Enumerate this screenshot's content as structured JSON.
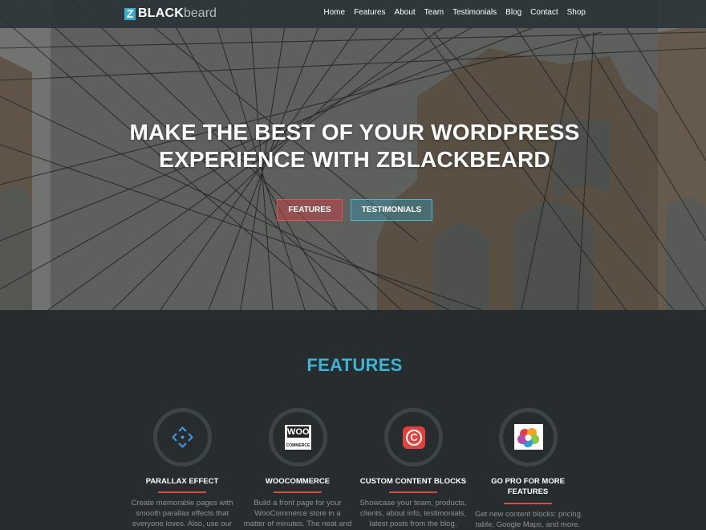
{
  "colors": {
    "accent_blue": "#3fb3d3",
    "accent_red": "#d84b4b",
    "background": "#272d2f",
    "navbar": "#2b3438"
  },
  "logo": {
    "mark": "Z",
    "bold": "BLACK",
    "light": "beard"
  },
  "nav": {
    "items": [
      "Home",
      "Features",
      "About",
      "Team",
      "Testimonials",
      "Blog",
      "Contact",
      "Shop"
    ]
  },
  "hero": {
    "title_line1": "MAKE THE BEST OF YOUR WORDPRESS",
    "title_line2": "EXPERIENCE WITH ZBLACKBEARD",
    "btn_features": "FEATURES",
    "btn_testimonials": "TESTIMONIALS"
  },
  "features": {
    "title": "FEATURES",
    "items": [
      {
        "icon": "arrows-move-icon",
        "title": "PARALLAX EFFECT",
        "desc": [
          "Create memorable pages with",
          "smooth parallax effects that",
          "everyone loves. Also, use our"
        ]
      },
      {
        "icon": "woocommerce-icon",
        "icon_text": "WOO",
        "icon_sub": "COMMERCE",
        "title": "WOOCOMMERCE",
        "desc": [
          "Build a front page for your",
          "WooCommerce store in a",
          "matter of minutes. The neat and"
        ]
      },
      {
        "icon": "content-block-icon",
        "icon_text": "C",
        "title": "CUSTOM CONTENT BLOCKS",
        "desc": [
          "Showcase your team, products,",
          "clients, about info, testimonials,",
          "latest posts from the blog,"
        ]
      },
      {
        "icon": "flower-logo-icon",
        "title_lines": [
          "GO PRO FOR MORE",
          "FEATURES"
        ],
        "desc": [
          "Get new content blocks: pricing",
          "table, Google Maps, and more."
        ]
      }
    ]
  }
}
